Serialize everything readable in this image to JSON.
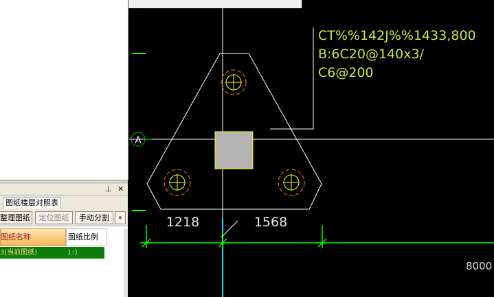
{
  "panel": {
    "pin_icon": "pin-icon",
    "close_icon": "close-icon",
    "tab_label": "图纸楼层对照表",
    "toolbar": {
      "manage_label": "整理图纸",
      "locate_label": "定位图纸",
      "split_label": "手动分割",
      "more_label": "»"
    },
    "table": {
      "headers": [
        "图纸名称",
        "图纸比例"
      ],
      "rows": [
        {
          "name": "3(当前图纸)",
          "scale": "1:1"
        }
      ]
    }
  },
  "cad": {
    "annotation_lines": [
      "CT%%142J%%1433,800",
      "B:6C20@140x3/",
      "C6@200"
    ],
    "axis_label": "A",
    "dimensions": [
      "1218",
      "1568"
    ],
    "right_label": "8000",
    "colors": {
      "background": "#000000",
      "annotation": "#c8e63c",
      "outline": "#ffffff",
      "dimension": "#00ff00",
      "axis_bubble": "#00c800",
      "rebar_circle": "#e06020",
      "rebar_cross": "#ffff00",
      "column_fill": "#b4b4b4",
      "column_edge": "#ffff00",
      "crosshair_vertical": "#00e5ff"
    }
  }
}
